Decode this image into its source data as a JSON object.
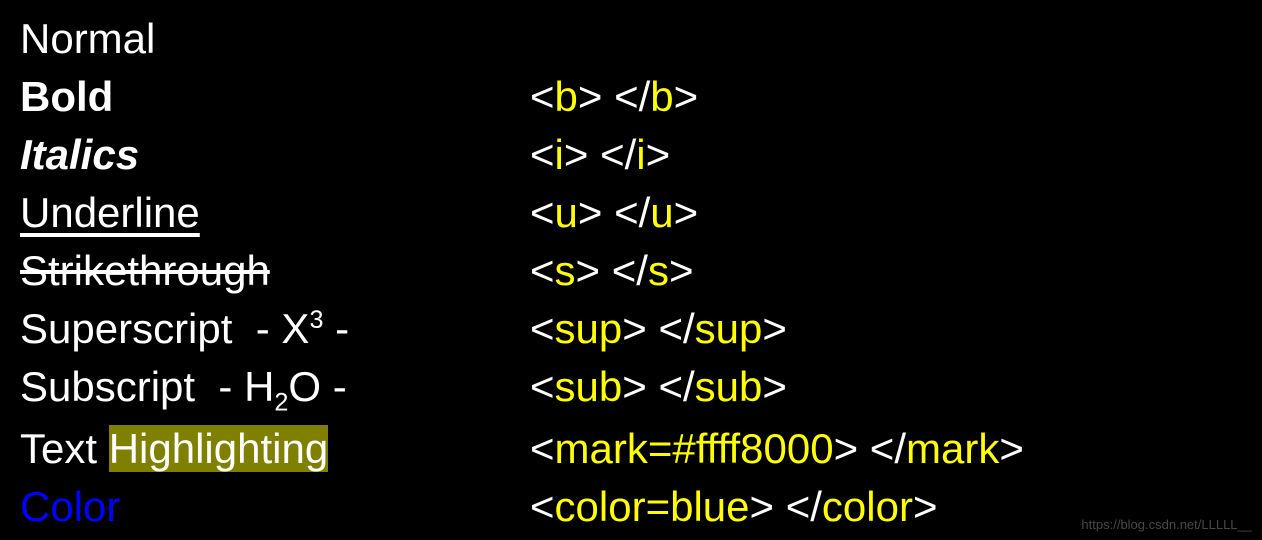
{
  "rows": {
    "normal": {
      "label": "Normal"
    },
    "bold": {
      "label": "Bold",
      "tag_open_lt": "<",
      "tag_open_name": "b",
      "tag_open_gt": "> ",
      "tag_close_lt": "</",
      "tag_close_name": "b",
      "tag_close_gt": ">"
    },
    "italics": {
      "label": "Italics",
      "tag_open_lt": "<",
      "tag_open_name": "i",
      "tag_open_gt": "> ",
      "tag_close_lt": "</",
      "tag_close_name": "i",
      "tag_close_gt": ">"
    },
    "underline": {
      "label": "Underline",
      "tag_open_lt": "<",
      "tag_open_name": "u",
      "tag_open_gt": "> ",
      "tag_close_lt": "</",
      "tag_close_name": "u",
      "tag_close_gt": ">"
    },
    "strike": {
      "label": "Strikethrough",
      "tag_open_lt": "<",
      "tag_open_name": "s",
      "tag_open_gt": "> ",
      "tag_close_lt": "</",
      "tag_close_name": "s",
      "tag_close_gt": ">"
    },
    "superscript": {
      "label_prefix": "Superscript  - X",
      "label_sup": "3",
      "label_suffix": " -",
      "tag_open_lt": "<",
      "tag_open_name": "sup",
      "tag_open_gt": "> ",
      "tag_close_lt": "</",
      "tag_close_name": "sup",
      "tag_close_gt": ">"
    },
    "subscript": {
      "label_prefix": "Subscript  - H",
      "label_sub": "2",
      "label_suffix": "O -",
      "tag_open_lt": "<",
      "tag_open_name": "sub",
      "tag_open_gt": "> ",
      "tag_close_lt": "</",
      "tag_close_name": "sub",
      "tag_close_gt": ">"
    },
    "highlight": {
      "label_prefix": "Text ",
      "label_marked": "Highlighting",
      "tag_open_lt": "<",
      "tag_open_name": "mark=#ffff8000",
      "tag_open_gt": "> ",
      "tag_close_lt": "</",
      "tag_close_name": "mark",
      "tag_close_gt": ">"
    },
    "color": {
      "label": "Color",
      "tag_open_lt": "<",
      "tag_open_name": "color=blue",
      "tag_open_gt": "> ",
      "tag_close_lt": "</",
      "tag_close_name": "color",
      "tag_close_gt": ">"
    }
  },
  "watermark": "https://blog.csdn.net/LLLLL__"
}
